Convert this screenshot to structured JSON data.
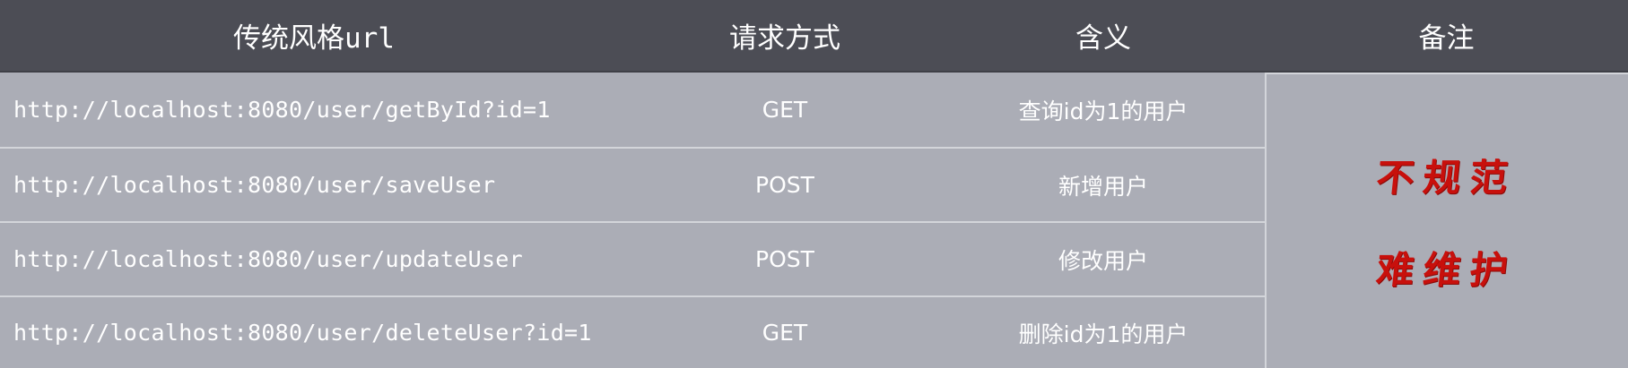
{
  "header": {
    "url": "传统风格url",
    "method": "请求方式",
    "meaning": "含义",
    "note": "备注"
  },
  "rows": [
    {
      "url": "http://localhost:8080/user/getById?id=1",
      "method": "GET",
      "meaning": "查询id为1的用户"
    },
    {
      "url": "http://localhost:8080/user/saveUser",
      "method": "POST",
      "meaning": "新增用户"
    },
    {
      "url": "http://localhost:8080/user/updateUser",
      "method": "POST",
      "meaning": "修改用户"
    },
    {
      "url": "http://localhost:8080/user/deleteUser?id=1",
      "method": "GET",
      "meaning": "删除id为1的用户"
    }
  ],
  "note": {
    "line1": "不规范",
    "line2": "难维护",
    "color": "#c8100c"
  },
  "colors": {
    "header_bg": "#4c4d55",
    "body_bg": "#abadb6",
    "divider": "#d3d5da"
  }
}
